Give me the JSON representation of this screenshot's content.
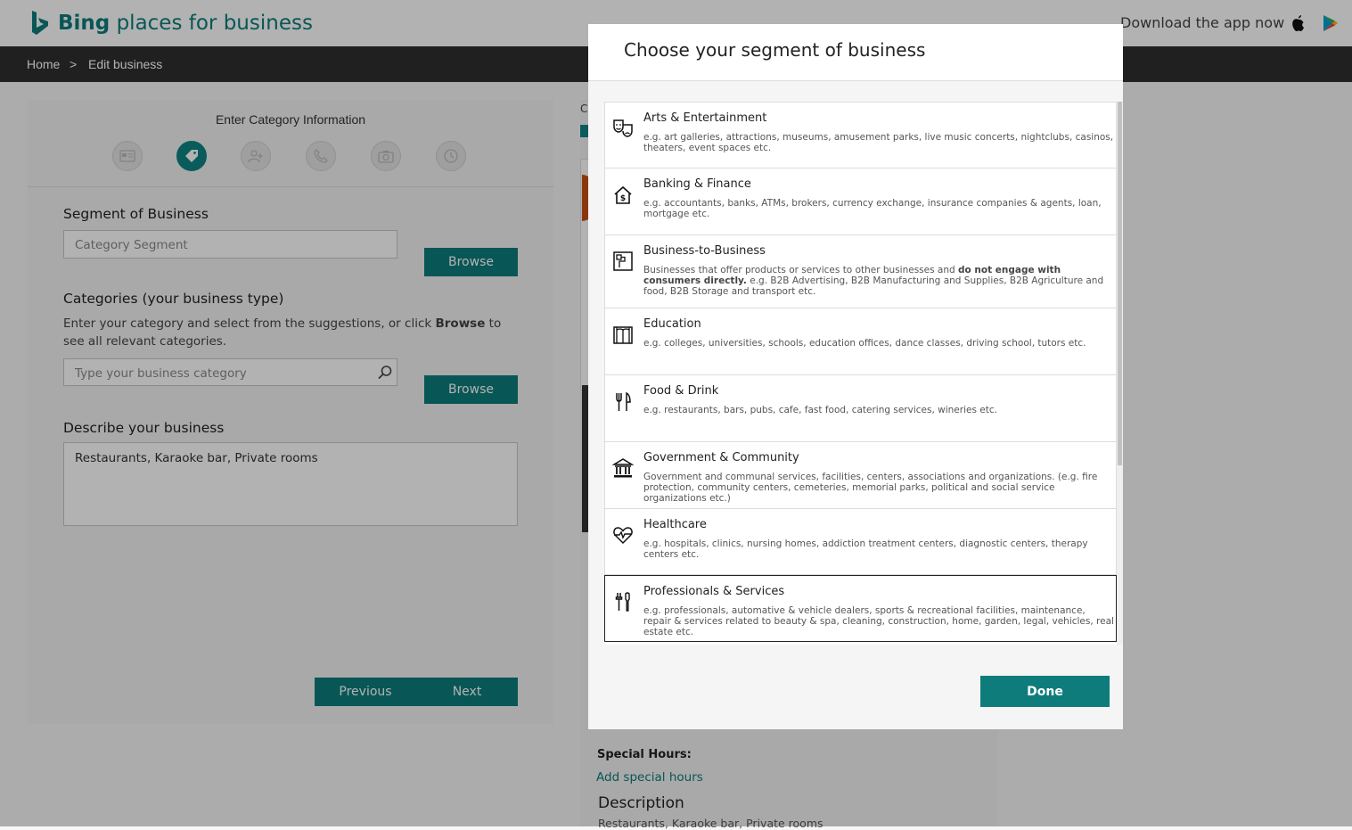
{
  "header": {
    "brand_bold": "Bing",
    "brand_rest": "places for business",
    "download_text": "Download the app now",
    "apple_icon": "apple-icon",
    "play_icon": "google-play-icon"
  },
  "breadcrumb": {
    "home": "Home",
    "separator": ">",
    "current": "Edit business"
  },
  "wizard": {
    "title": "Enter Category Information",
    "steps": [
      "business-card-icon",
      "tag-icon",
      "people-icon",
      "phone-icon",
      "camera-icon",
      "clock-icon"
    ],
    "active_step": 1
  },
  "form": {
    "segment_label": "Segment of Business",
    "segment_placeholder": "Category Segment",
    "browse_label": "Browse",
    "categories_label": "Categories (your business type)",
    "help_pre": "Enter your category and select from the suggestions, or click ",
    "help_bold": "Browse",
    "help_post": " to see all relevant categories.",
    "category_placeholder": "Type your business category",
    "describe_label": "Describe your business",
    "describe_value": "Restaurants, Karaoke bar, Private rooms",
    "previous_label": "Previous",
    "next_label": "Next"
  },
  "side": {
    "special_hours_label": "Special Hours:",
    "add_special_hours": "Add special hours",
    "description_label": "Description",
    "description_value": "Restaurants, Karaoke bar, Private rooms",
    "partial_letter": "C"
  },
  "modal": {
    "title": "Choose your segment of business",
    "done_label": "Done",
    "items": [
      {
        "icon": "theater-masks-icon",
        "title": "Arts & Entertainment",
        "desc": "e.g. art galleries, attractions, museums, amusement parks, live music concerts, nightclubs, casinos, theaters, event spaces etc."
      },
      {
        "icon": "bank-house-icon",
        "title": "Banking & Finance",
        "desc": "e.g. accountants, banks, ATMs, brokers, currency exchange, insurance companies & agents, loan, mortgage etc."
      },
      {
        "icon": "building-blocks-icon",
        "title": "Business-to-Business",
        "desc_pre": "Businesses that offer products or services to other businesses and ",
        "desc_bold": "do not engage with consumers directly.",
        "desc_post": " e.g. B2B Advertising, B2B Manufacturing and Supplies, B2B Agriculture and food, B2B Storage and transport etc."
      },
      {
        "icon": "book-icon",
        "title": "Education",
        "desc": "e.g. colleges, universities, schools, education offices, dance classes, driving school, tutors etc."
      },
      {
        "icon": "fork-knife-icon",
        "title": "Food & Drink",
        "desc": "e.g. restaurants, bars, pubs, cafe, fast food, catering services, wineries etc."
      },
      {
        "icon": "government-building-icon",
        "title": "Government & Community",
        "desc": "Government and communal services, facilities, centers, associations and organizations. (e.g. fire protection, community centers, cemeteries, memorial parks, political and social service organizations etc.)"
      },
      {
        "icon": "heartbeat-icon",
        "title": "Healthcare",
        "desc": "e.g. hospitals, clinics, nursing homes, addiction treatment centers, diagnostic centers, therapy centers etc."
      },
      {
        "icon": "tools-icon",
        "title": "Professionals & Services",
        "desc": "e.g. professionals, automative & vehicle dealers, sports & recreational facilities, maintenance, repair & services related to beauty & spa, cleaning, construction, home, garden, legal, vehicles, real estate etc."
      }
    ],
    "selected_index": 7
  }
}
